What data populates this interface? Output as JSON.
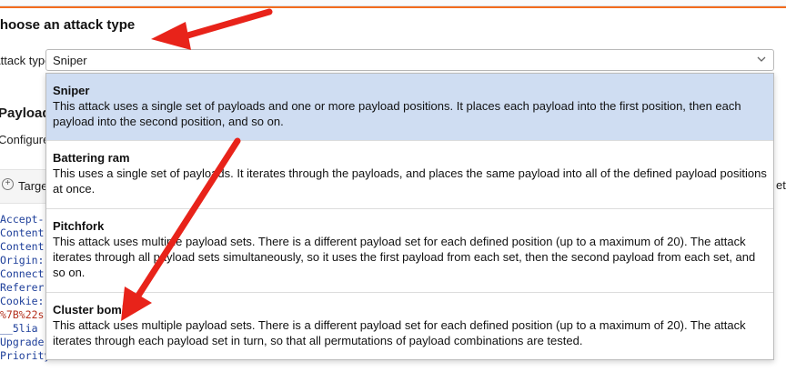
{
  "header": {
    "title": "Choose an attack type"
  },
  "attack_type": {
    "label": "Attack type:",
    "selected": "Sniper"
  },
  "payload_section": {
    "title": "Payload positions",
    "description": "Configure the positions where payloads will be inserted"
  },
  "target": {
    "label": "Target"
  },
  "right_cutoff": "et",
  "request_lines": [
    {
      "text": "Accept-",
      "color": "blue"
    },
    {
      "text": "Content",
      "color": "blue"
    },
    {
      "text": "Content",
      "color": "blue"
    },
    {
      "text": "Origin:",
      "color": "blue"
    },
    {
      "text": "Connect",
      "color": "blue"
    },
    {
      "text": "Referer",
      "color": "blue"
    },
    {
      "text": "Cookie:",
      "color": "blue"
    },
    {
      "text": "%7B%22s",
      "color": "red"
    },
    {
      "text": "__5lia",
      "color": "blue"
    },
    {
      "text": "Upgrade",
      "color": "blue"
    },
    {
      "text": "Priority",
      "color": "blue"
    }
  ],
  "options": [
    {
      "name": "Sniper",
      "description": "This attack uses a single set of payloads and one or more payload positions. It places each payload into the first position, then each payload into the second position, and so on."
    },
    {
      "name": "Battering ram",
      "description": "This uses a single set of payloads. It iterates through the payloads, and places the same payload into all of the defined payload positions at once."
    },
    {
      "name": "Pitchfork",
      "description": "This attack uses multiple payload sets. There is a different payload set for each defined position (up to a maximum of 20). The attack iterates through all payload sets simultaneously, so it uses the first payload from each set, then the second payload from each set, and so on."
    },
    {
      "name": "Cluster bomb",
      "description": "This attack uses multiple payload sets. There is a different payload set for each defined position (up to a maximum of 20). The attack iterates through each payload set in turn, so that all permutations of payload combinations are tested."
    }
  ],
  "colors": {
    "accent": "#f26b1d",
    "selected_bg": "#cfddf2",
    "arrow": "#e8231a"
  },
  "icons": {
    "dropdown": "chevron-down-icon",
    "add": "plus-circle-icon"
  }
}
